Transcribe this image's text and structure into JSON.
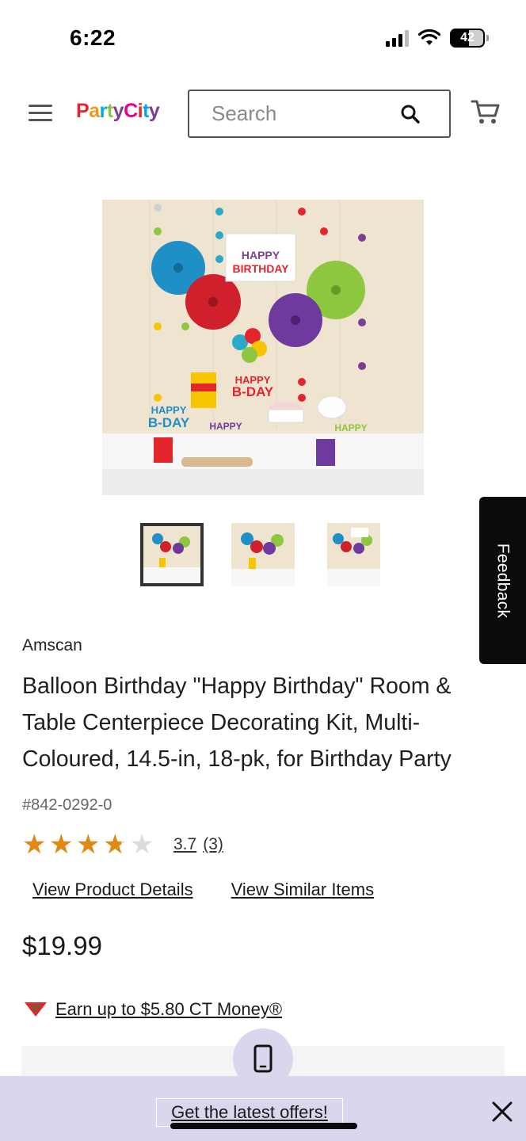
{
  "status_bar": {
    "time": "6:22",
    "battery": "42"
  },
  "header": {
    "logo_text": "PartyCity",
    "search_placeholder": "Search"
  },
  "product": {
    "brand": "Amscan",
    "title": "Balloon Birthday \"Happy Birthday\" Room & Table Centerpiece Decorating Kit, Multi-Coloured, 14.5-in, 18-pk, for Birthday Party",
    "sku": "#842-0292-0",
    "rating": 3.7,
    "rating_text": "3.7",
    "review_count_text": "(3)",
    "view_details_label": "View Product Details",
    "view_similar_label": "View Similar Items",
    "price": "$19.99",
    "ct_money_label": "Earn up to $5.80 CT Money®",
    "thumbnails_count": 3,
    "selected_thumbnail": 1
  },
  "feedback": {
    "label": "Feedback"
  },
  "offer_banner": {
    "label": "Get the latest offers!"
  },
  "colors": {
    "star": "#e08a14",
    "banner": "#d9d6ee",
    "feedback_bg": "#0b0b0b"
  }
}
